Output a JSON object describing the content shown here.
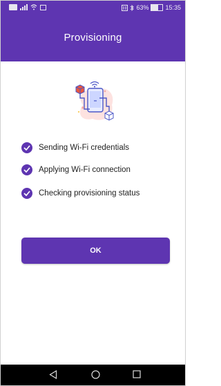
{
  "status_bar": {
    "battery_text": "63%",
    "time": "15:35"
  },
  "app_bar": {
    "title": "Provisioning"
  },
  "steps": [
    {
      "label": "Sending Wi-Fi credentials",
      "status": "done"
    },
    {
      "label": "Applying Wi-Fi connection",
      "status": "done"
    },
    {
      "label": "Checking provisioning status",
      "status": "done"
    }
  ],
  "ok_button": {
    "label": "OK"
  },
  "nav_bar": {
    "back_icon": "back-triangle-icon",
    "home_icon": "home-circle-icon",
    "recents_icon": "recents-square-icon"
  },
  "colors": {
    "primary": "#5e35b1",
    "illustration_blob": "#fde2e0"
  }
}
